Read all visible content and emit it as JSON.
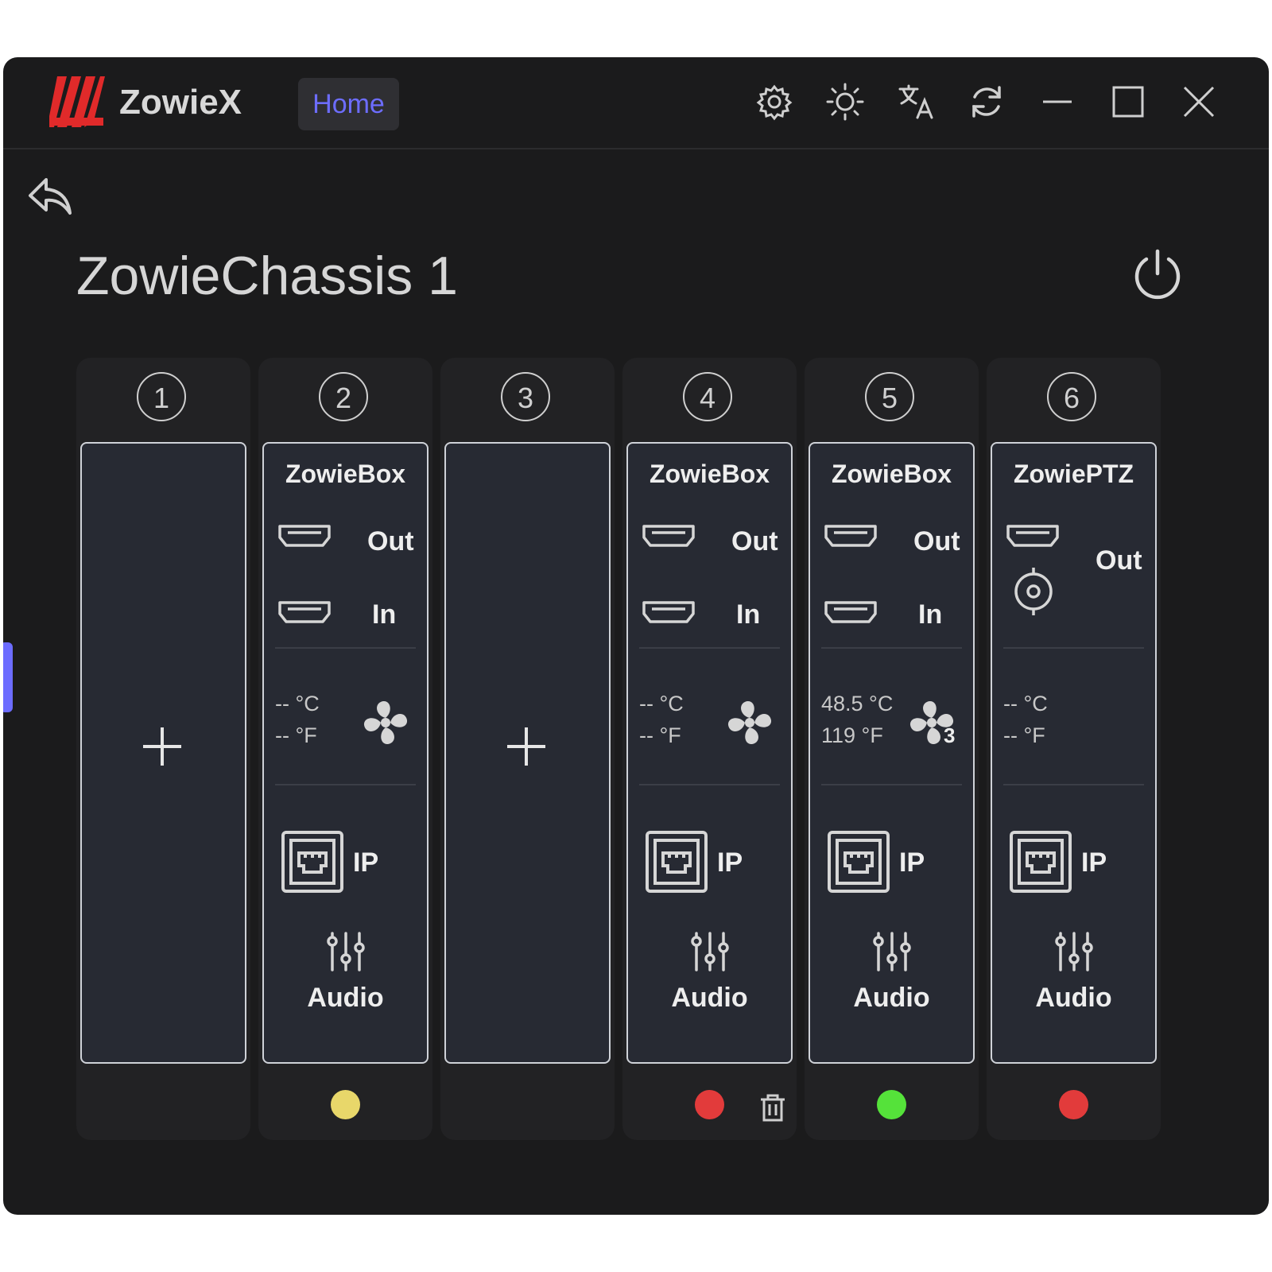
{
  "app": {
    "name": "ZowieX",
    "home_tab": "Home"
  },
  "title_icons": [
    "gear-icon",
    "sun-icon",
    "translate-icon",
    "refresh-icon",
    "minimize-icon",
    "maximize-icon",
    "close-icon"
  ],
  "chassis": {
    "title": "ZowieChassis 1"
  },
  "colors": {
    "accent": "#6c6cff",
    "logo": "#e02a2a",
    "yellow": "#e8d76a",
    "red": "#e23b3b",
    "green": "#55e23a"
  },
  "slots": [
    {
      "number": "1",
      "empty": true
    },
    {
      "number": "2",
      "device": "ZowieBox",
      "out": "Out",
      "in": "In",
      "temp_c": "-- °C",
      "temp_f": "-- °F",
      "ip": "IP",
      "audio": "Audio",
      "status": "yellow"
    },
    {
      "number": "3",
      "empty": true
    },
    {
      "number": "4",
      "device": "ZowieBox",
      "out": "Out",
      "in": "In",
      "temp_c": "-- °C",
      "temp_f": "-- °F",
      "ip": "IP",
      "audio": "Audio",
      "status": "red",
      "delete": true
    },
    {
      "number": "5",
      "device": "ZowieBox",
      "out": "Out",
      "in": "In",
      "temp_c": "48.5 °C",
      "temp_f": "119 °F",
      "fan_count": "3",
      "ip": "IP",
      "audio": "Audio",
      "status": "green"
    },
    {
      "number": "6",
      "device": "ZowiePTZ",
      "out": "Out",
      "temp_c": "-- °C",
      "temp_f": "-- °F",
      "ip": "IP",
      "audio": "Audio",
      "status": "red"
    }
  ]
}
